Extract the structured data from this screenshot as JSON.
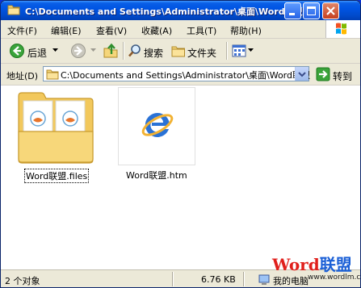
{
  "window": {
    "title": "C:\\Documents and Settings\\Administrator\\桌面\\Word联盟"
  },
  "menu": {
    "items": [
      {
        "label": "文件(F)"
      },
      {
        "label": "编辑(E)"
      },
      {
        "label": "查看(V)"
      },
      {
        "label": "收藏(A)"
      },
      {
        "label": "工具(T)"
      },
      {
        "label": "帮助(H)"
      }
    ]
  },
  "toolbar": {
    "back_label": "后退",
    "search_label": "搜索",
    "folders_label": "文件夹"
  },
  "address": {
    "label": "地址(D)",
    "value": "C:\\Documents and Settings\\Administrator\\桌面\\Word联盟",
    "go_label": "转到"
  },
  "files": [
    {
      "name": "Word联盟.files",
      "type": "folder",
      "selected": true
    },
    {
      "name": "Word联盟.htm",
      "type": "htm",
      "selected": false
    }
  ],
  "status": {
    "object_count": "2 个对象",
    "size": "6.76 KB",
    "location": "我的电脑"
  },
  "watermark": {
    "brand_word": "Word",
    "brand_cn": "联盟",
    "url": "www.wordlm.com"
  },
  "colors": {
    "titlebar_blue": "#0054e3",
    "watermark_red": "#e0201c",
    "watermark_blue": "#1a5fd6"
  }
}
